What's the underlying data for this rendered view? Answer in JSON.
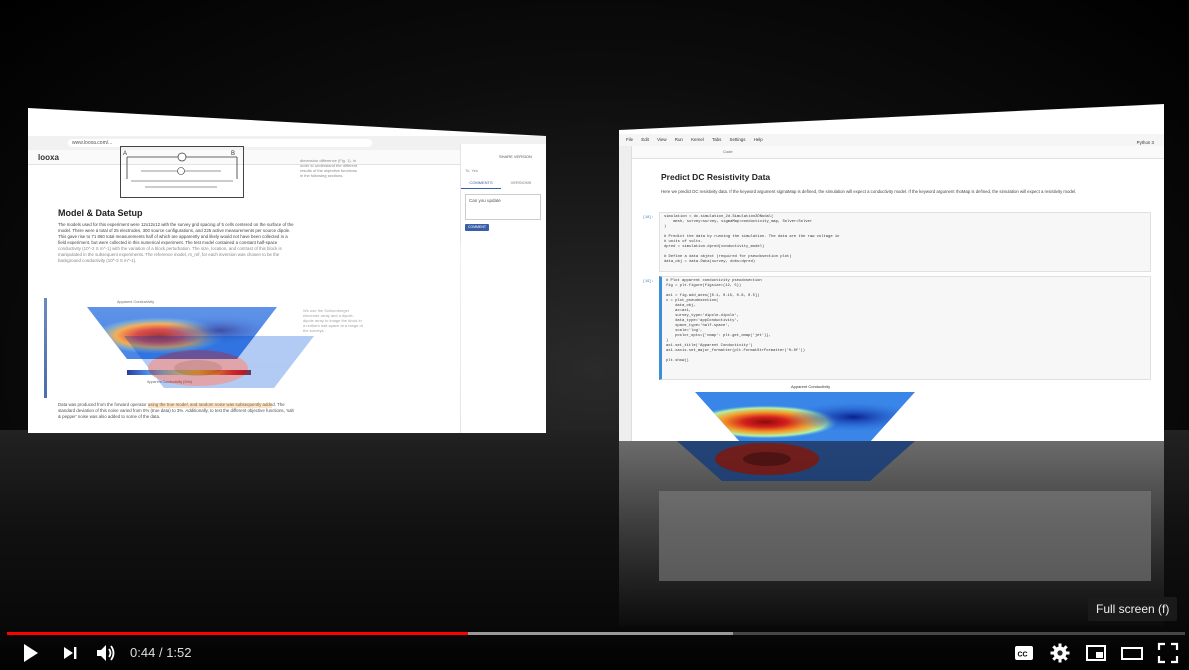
{
  "left_screen": {
    "url": "www.looxa.com/...",
    "logo": "looxa",
    "section_title": "Model & Data Setup",
    "paragraph": "The models used for this experiment were 12x12x12 with the survey grid spacing of 5 cells centered on the surface of the model. There were a total of 25 electrodes, 300 source configurations, and 225 active measurements per source dipole. This gave rise to 71 860 total measurements half of which are apparently and likely would not have been collected in a field experiment, but were collected in this numerical experiment. The test model contained a constant half-space conductivity (10^-2 S m^-1) with the variation of a block perturbation. The size, location, and contrast of this block is manipulated in the subsequent experiments. The reference model, m_ref, for each inversion was chosen to be the background conductivity (10^-2 S m^-1).",
    "paragraph2": "Data was produced from the forward operator using the true model, and random noise was subsequently added. The standard deviation of this noise varied from 0% (true data) to 3%. Additionally, to test the different objective functions, 'salt & pepper' noise was also added to some of the data.",
    "figure_title": "Apparent Conductivity",
    "figure_xlabel": "Apparent Conductivity (S/m)",
    "figure_note": "We use the Schlumberger electrode array and a dipole-dipole array to image the block in a uniform half-space at a range of the surveys.",
    "side_note": "dimension difference (Fig. 1). In order to understand the different results of the objective functions in the following sections.",
    "comments_panel": {
      "share_label": "SHARE VERSION",
      "to_label": "To: Yes",
      "tab_comments": "COMMENTS",
      "tab_versions": "VERSIONS",
      "comment_text": "Can you update",
      "comment_button": "COMMENT"
    }
  },
  "right_screen": {
    "menu": [
      "File",
      "Edit",
      "View",
      "Run",
      "Kernel",
      "Tabs",
      "Settings",
      "Help"
    ],
    "kernel": "Python 3",
    "cell_type": "Code",
    "title": "Predict DC Resistivity Data",
    "text": "Here we predict DC resistivity data. If the keyword argument sigmaMap is defined, the simulation will expect a conductivity model. If the keyword argument rhoMap is defined, the simulation will expect a resistivity model.",
    "cell1_prompt": "[18]:",
    "cell1": "simulation = dc.simulation_2d.Simulation2DNodal(\n    mesh, survey=survey, sigmaMap=conductivity_map, Solver=Solver\n)\n\n# Predict the data by running the simulation. The data are the raw voltage in\n# units of volts.\ndpred = simulation.dpred(conductivity_model)\n\n# Define a data object (required for pseudosection plot)\ndata_obj = data.Data(survey, dobs=dpred)",
    "cell2_prompt": "[19]:",
    "cell2": "# Plot apparent conductivity pseudosection\nfig = plt.figure(figsize=(12, 5))\n\nax1 = fig.add_axes([0.1, 0.15, 0.8, 0.5])\nx = plot_pseudosection(\n    data_obj,\n    ax=ax1,\n    survey_type='dipole-dipole',\n    data_type='appConductivity',\n    space_type='half-space',\n    scale='log',\n    pcolor_opts={'cmap': plt.get_cmap('jet')},\n)\nax1.set_title('Apparent Conductivity')\nax1.xaxis.set_major_formatter(plt.FormatStrFormatter('%.0f'))\n\nplt.show()",
    "plot_title": "Apparent Conductivity"
  },
  "player": {
    "current_time": "0:44",
    "separator": "/",
    "duration": "1:52",
    "played_fraction": 0.391,
    "buffered_fraction": 0.616,
    "tooltip": "Full screen (f)",
    "accent": "#ff0000"
  }
}
